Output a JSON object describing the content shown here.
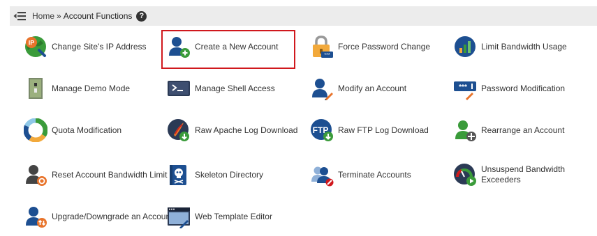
{
  "breadcrumb": {
    "home": "Home",
    "separator": "»",
    "current": "Account Functions",
    "help": "?"
  },
  "items": [
    {
      "label": "Change Site's IP Address",
      "icon": "ip-address-icon"
    },
    {
      "label": "Create a New Account",
      "icon": "create-account-icon"
    },
    {
      "label": "Force Password Change",
      "icon": "padlock-icon"
    },
    {
      "label": "Limit Bandwidth Usage",
      "icon": "bandwidth-chart-icon"
    },
    {
      "label": "Manage Demo Mode",
      "icon": "demo-switch-icon"
    },
    {
      "label": "Manage Shell Access",
      "icon": "terminal-icon"
    },
    {
      "label": "Modify an Account",
      "icon": "modify-account-icon"
    },
    {
      "label": "Password Modification",
      "icon": "password-field-icon"
    },
    {
      "label": "Quota Modification",
      "icon": "quota-pie-icon"
    },
    {
      "label": "Raw Apache Log Download",
      "icon": "apache-log-icon"
    },
    {
      "label": "Raw FTP Log Download",
      "icon": "ftp-log-icon"
    },
    {
      "label": "Rearrange an Account",
      "icon": "rearrange-account-icon"
    },
    {
      "label": "Reset Account Bandwidth Limit",
      "icon": "reset-bandwidth-icon"
    },
    {
      "label": "Skeleton Directory",
      "icon": "skeleton-directory-icon"
    },
    {
      "label": "Terminate Accounts",
      "icon": "terminate-accounts-icon"
    },
    {
      "label": "Unsuspend Bandwidth Exceeders",
      "icon": "unsuspend-gauge-icon"
    },
    {
      "label": "Upgrade/Downgrade an Account",
      "icon": "upgrade-account-icon"
    },
    {
      "label": "Web Template Editor",
      "icon": "web-template-icon"
    }
  ],
  "colors": {
    "highlight_border": "#d0181d",
    "primary_blue": "#1d4f91",
    "accent_green": "#3a9b3a",
    "accent_orange": "#e8732a"
  }
}
